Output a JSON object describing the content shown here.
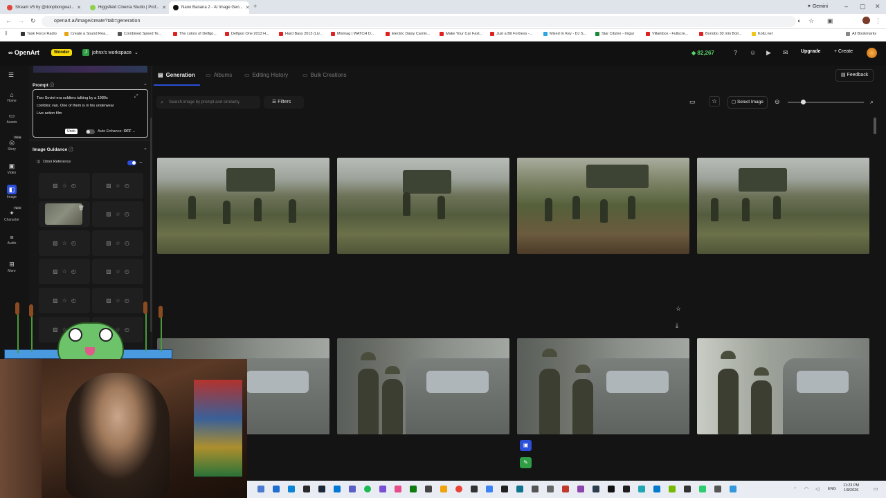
{
  "browser": {
    "tabs": [
      {
        "label": "Stream V5 by @donpbongwat...",
        "color": "#e0453a",
        "active": false
      },
      {
        "label": "Higgsfield Cinema Studio | Prof...",
        "color": "#8fd14f",
        "active": false
      },
      {
        "label": "Nano Banana 2 - AI Image Gen...",
        "color": "#111111",
        "active": true
      }
    ],
    "gemini_label": "Gemini",
    "url": "openart.ai/image/create?tab=generation",
    "bookmarks": [
      "Task Force Radio",
      "Create a Sound Rea...",
      "Combined Speed Te...",
      "The colors of Delfgo...",
      "Delfgoo One 2013 H...",
      "Hard Bass 2013 (Liv...",
      "Mixmag | WATCH D...",
      "Electric Daisy Carniv...",
      "Make Your Car Fast...",
      "Just a Bit Fortress -...",
      "Mixed In Key - DJ S...",
      "Star Citizen - Imgur",
      "Villainbox - Fullscre...",
      "Bonobo 30 min Boil...",
      "Kollz.net"
    ],
    "all_bookmarks": "All Bookmarks"
  },
  "app": {
    "logo": "OpenArt",
    "badge": "Wonder",
    "workspace_initial": "J",
    "workspace": "johnx's workspace",
    "credits": "82,267",
    "upgrade": "Upgrade",
    "create": "Create",
    "feedback": "Feedback"
  },
  "rail": [
    {
      "label": "Home",
      "icon": "home-icon"
    },
    {
      "label": "Assets",
      "icon": "assets-icon"
    },
    {
      "label": "Story",
      "icon": "story-icon",
      "tag": "Beta"
    },
    {
      "label": "Video",
      "icon": "video-icon"
    },
    {
      "label": "Image",
      "icon": "image-icon",
      "active": true
    },
    {
      "label": "Character",
      "icon": "character-icon",
      "tag": "New"
    },
    {
      "label": "Audio",
      "icon": "audio-icon"
    },
    {
      "label": "More",
      "icon": "more-icon"
    }
  ],
  "panel": {
    "prompt_title": "Prompt",
    "prompt_lines": [
      "Two Soviet era soldiers talking by a 1980s",
      "combloc van. One of them is in his underwear",
      "Live action film"
    ],
    "undo": "Undo",
    "auto_enhance": "Auto Enhance:",
    "auto_enhance_state": "OFF",
    "image_guidance": "Image Guidance",
    "omni_reference": "Omni Reference"
  },
  "main": {
    "tabs": [
      "Generation",
      "Albums",
      "Editing History",
      "Bulk Creations"
    ],
    "active_tab": "Generation",
    "search_placeholder": "Search image by prompt and similarity",
    "filters": "Filters",
    "select_image": "Select Image",
    "zoom_fraction": 0.2
  },
  "taskbar": {
    "language": "ENG",
    "time": "11:23 PM",
    "date": "1/9/2026"
  },
  "colors": {
    "accent": "#2b4fd8",
    "credits": "#5bd36b",
    "badge": "#f5d90a"
  }
}
